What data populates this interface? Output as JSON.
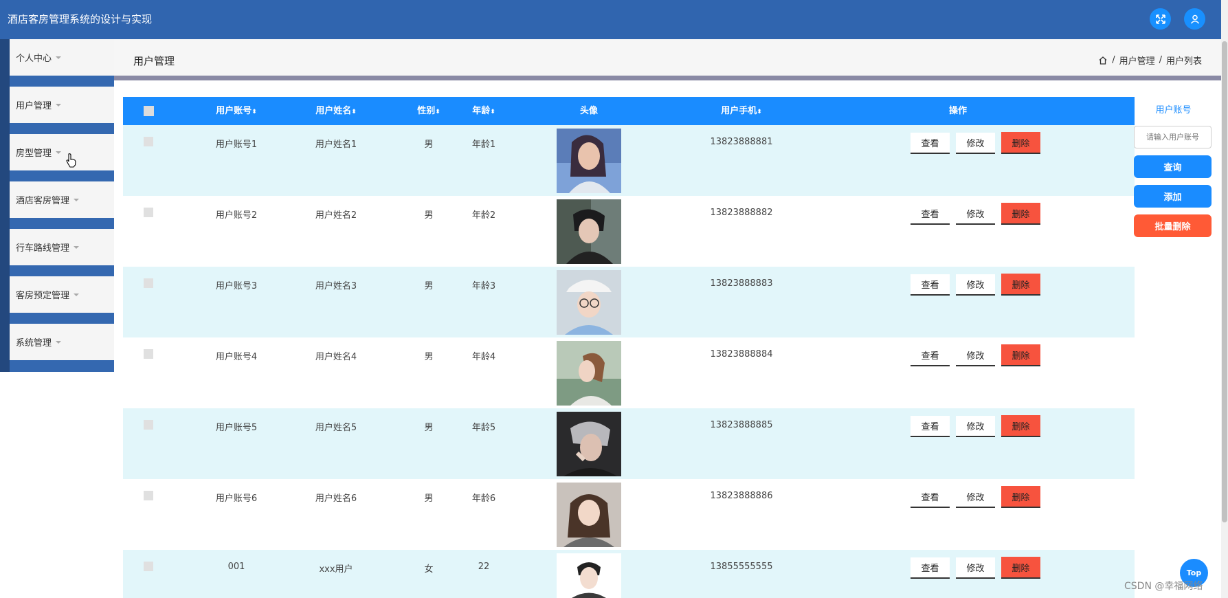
{
  "app": {
    "title": "酒店客房管理系统的设计与实现"
  },
  "sidebar": {
    "items": [
      {
        "label": "个人中心"
      },
      {
        "label": "用户管理"
      },
      {
        "label": "房型管理"
      },
      {
        "label": "酒店客房管理"
      },
      {
        "label": "行车路线管理"
      },
      {
        "label": "客房预定管理"
      },
      {
        "label": "系统管理"
      }
    ]
  },
  "page": {
    "title": "用户管理",
    "breadcrumb": [
      "用户管理",
      "用户列表"
    ],
    "breadcrumb_sep": "/"
  },
  "table": {
    "columns": [
      {
        "label": "用户账号",
        "sort": "⬍"
      },
      {
        "label": "用户姓名",
        "sort": "⬍"
      },
      {
        "label": "性别",
        "sort": "⬍"
      },
      {
        "label": "年龄",
        "sort": "⬍"
      },
      {
        "label": "头像",
        "sort": ""
      },
      {
        "label": "用户手机",
        "sort": "⬍"
      },
      {
        "label": "操作",
        "sort": ""
      }
    ],
    "actions": {
      "view": "查看",
      "edit": "修改",
      "delete": "删除"
    },
    "rows": [
      {
        "account": "用户账号1",
        "name": "用户姓名1",
        "gender": "男",
        "age": "年龄1",
        "phone": "13823888881"
      },
      {
        "account": "用户账号2",
        "name": "用户姓名2",
        "gender": "男",
        "age": "年龄2",
        "phone": "13823888882"
      },
      {
        "account": "用户账号3",
        "name": "用户姓名3",
        "gender": "男",
        "age": "年龄3",
        "phone": "13823888883"
      },
      {
        "account": "用户账号4",
        "name": "用户姓名4",
        "gender": "男",
        "age": "年龄4",
        "phone": "13823888884"
      },
      {
        "account": "用户账号5",
        "name": "用户姓名5",
        "gender": "男",
        "age": "年龄5",
        "phone": "13823888885"
      },
      {
        "account": "用户账号6",
        "name": "用户姓名6",
        "gender": "男",
        "age": "年龄6",
        "phone": "13823888886"
      },
      {
        "account": "001",
        "name": "xxx用户",
        "gender": "女",
        "age": "22",
        "phone": "13855555555"
      }
    ]
  },
  "search": {
    "label": "用户账号",
    "placeholder": "请输入用户账号",
    "query_label": "查询",
    "add_label": "添加",
    "batch_delete_label": "批量删除"
  },
  "back_to_top": "Top",
  "watermark": "CSDN @幸福网络",
  "colors": {
    "header": "#3065AF",
    "accent": "#1a8cff",
    "danger": "#f7533e",
    "row_alt": "#e2f6fa"
  }
}
